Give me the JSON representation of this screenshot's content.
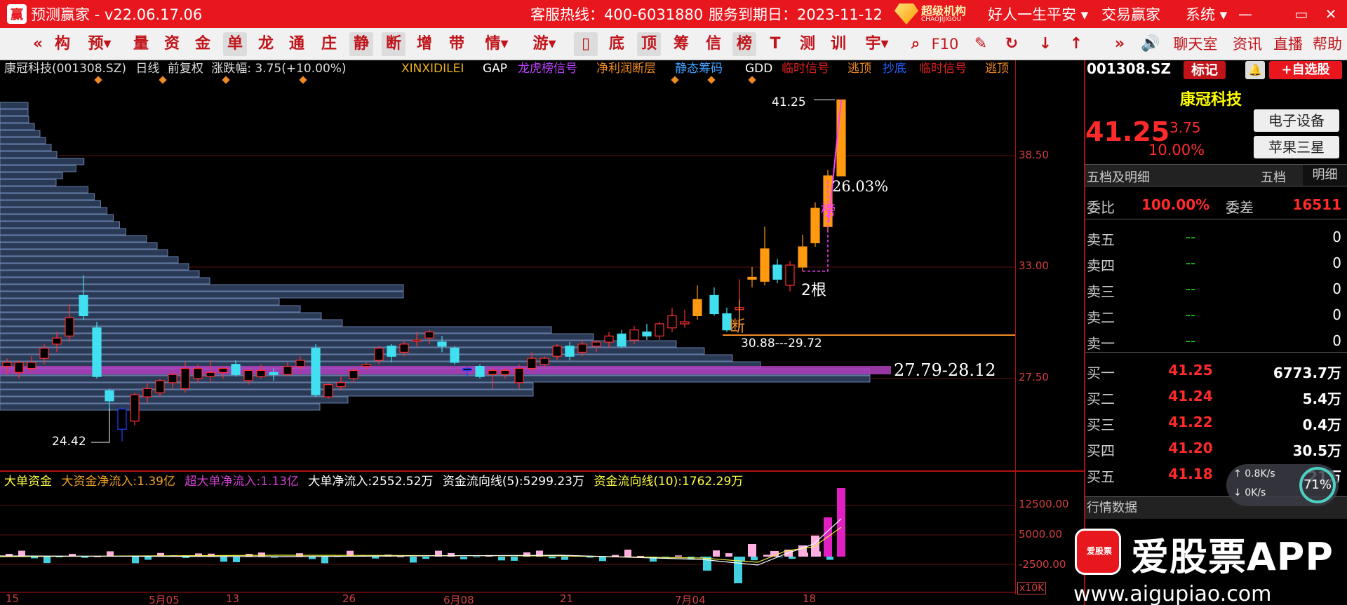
{
  "titlebar": {
    "app_title": "预测赢家 - v22.06.17.06",
    "hotline": "客服热线：400-6031880",
    "expire": "服务到期日：2023-11-12",
    "vip_cn": "超级机构",
    "vip_en": "CHAOJIJIGOU",
    "user": "好人一生平安 ▾",
    "trade": "交易赢家",
    "system": "系统 ▾",
    "min": "—",
    "max": "▭",
    "close": "✕",
    "logo_char": "赢"
  },
  "toolbar": {
    "items": [
      "«",
      "构",
      "预▾",
      "量",
      "资",
      "金",
      "单",
      "龙",
      "通",
      "庄",
      "静",
      "断",
      "增",
      "带",
      "情▾",
      "游▾",
      "底",
      "顶",
      "筹",
      "信",
      "榜",
      "T",
      "测",
      "训",
      "宇▾",
      "F10",
      "»",
      "聊天室",
      "资讯",
      "直播",
      "帮助"
    ]
  },
  "chart_header": {
    "stock": "康冠科技(001308.SZ)",
    "period": "日线",
    "adjust": "前复权",
    "change": "涨跌幅: 3.75(+10.00%)",
    "indicators": [
      {
        "label": "XINXIDILEI",
        "color": "#f0b020"
      },
      {
        "label": "GAP",
        "color": "#ffffff"
      },
      {
        "label": "龙虎榜信号",
        "color": "#c040ff"
      },
      {
        "label": "净利润断层",
        "color": "#f08a24"
      },
      {
        "label": "静态筹码",
        "color": "#40a0ff"
      },
      {
        "label": "GDD",
        "color": "#ffffff"
      },
      {
        "label": "临时信号",
        "color": "#e02020"
      },
      {
        "label": "逃顶",
        "color": "#f08a24"
      },
      {
        "label": "抄底",
        "color": "#2060ff"
      },
      {
        "label": "临时信号",
        "color": "#e02020"
      },
      {
        "label": "逃顶",
        "color": "#f08a24"
      }
    ]
  },
  "chart_labels": {
    "high": "41.25",
    "low": "24.42",
    "pct_rise": "26.03%",
    "bang": "榜",
    "days": "2根",
    "duan": "断",
    "gap_range": "30.88---29.72",
    "chip_range": "27.79-28.12",
    "unit": "x10K"
  },
  "chart_data": {
    "type": "candlestick",
    "y_ticks": [
      "38.50",
      "33.00",
      "27.50"
    ],
    "x_ticks": [
      "15",
      "5月05",
      "13",
      "26",
      "6月08",
      "21",
      "7月04",
      "18"
    ],
    "last_close": 41.25,
    "low": 24.42,
    "high": 41.25,
    "sub_y_ticks": [
      "12500.00",
      "5000.00",
      "-2500.00"
    ]
  },
  "sub_legend": {
    "name": "大单资金",
    "inflow": "大资金净流入:1.39亿",
    "super": "超大单净流入:1.13亿",
    "big": "大单净流入:2552.52万",
    "ma5": "资金流向线(5):5299.23万",
    "ma10": "资金流向线(10):1762.29万"
  },
  "right_panel": {
    "code": "001308.SZ",
    "tag": "标记",
    "bell": "🔔",
    "add_fav": "+自选股",
    "name": "康冠科技",
    "price": "41.25",
    "change": "3.75",
    "pct": "10.00%",
    "tag1": "电子设备",
    "tag2": "苹果三星",
    "tab_title": "五档及明细",
    "tab_wudang": "五档",
    "tab_mingxi": "明细",
    "weibi_label": "委比",
    "weibi": "100.00%",
    "weicha_label": "委差",
    "weicha": "16511",
    "asks": [
      {
        "label": "卖五",
        "price": "--",
        "vol": "0"
      },
      {
        "label": "卖四",
        "price": "--",
        "vol": "0"
      },
      {
        "label": "卖三",
        "price": "--",
        "vol": "0"
      },
      {
        "label": "卖二",
        "price": "--",
        "vol": "0"
      },
      {
        "label": "卖一",
        "price": "--",
        "vol": "0"
      }
    ],
    "bids": [
      {
        "label": "买一",
        "price": "41.25",
        "vol": "6773.7万"
      },
      {
        "label": "买二",
        "price": "41.24",
        "vol": "5.4万"
      },
      {
        "label": "买三",
        "price": "41.22",
        "vol": "0.4万"
      },
      {
        "label": "买四",
        "price": "41.20",
        "vol": "30.5万"
      },
      {
        "label": "买五",
        "price": "41.18",
        "vol": "21万"
      }
    ],
    "hq_title": "行情数据",
    "speed_up": "0.8K/s",
    "speed_down": "0K/s",
    "speed_pct": "71%"
  },
  "watermark": {
    "brand": "爱股票APP",
    "url": "www.aigupiao.com",
    "icon_text": "爱股票"
  }
}
